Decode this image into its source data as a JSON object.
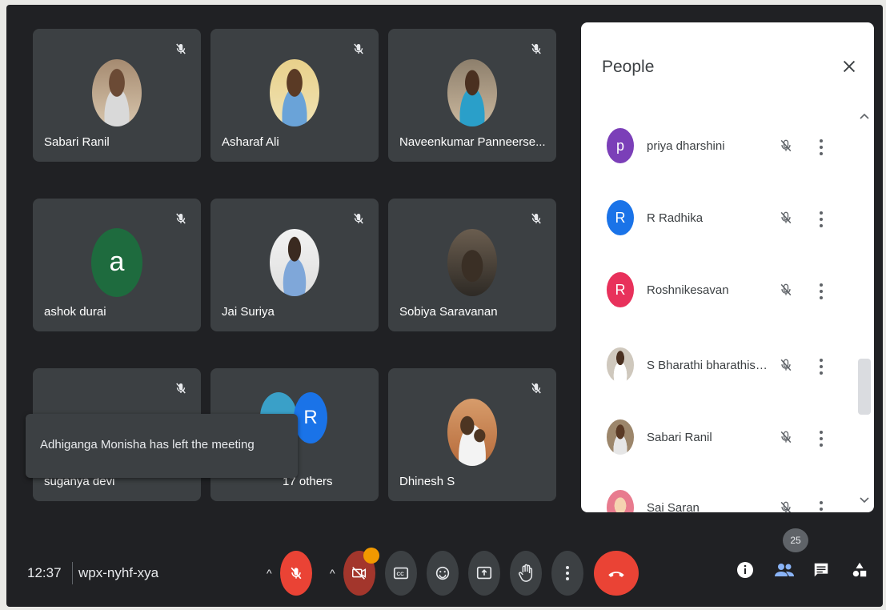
{
  "tiles": [
    {
      "name": "Sabari Ranil"
    },
    {
      "name": "Asharaf Ali"
    },
    {
      "name": "Naveenkumar Panneerse..."
    },
    {
      "name": "ashok durai",
      "initial": "a"
    },
    {
      "name": "Jai Suriya"
    },
    {
      "name": "Sobiya Saravanan"
    },
    {
      "name": "suganya devi"
    },
    {
      "name": "17 others",
      "initial": "R"
    },
    {
      "name": "Dhinesh S"
    }
  ],
  "toast": {
    "text": "Adhiganga Monisha has left the meeting"
  },
  "people_panel": {
    "title": "People",
    "participants": [
      {
        "name": "priya dharshini",
        "initial": "p",
        "color": "#7b3fb8"
      },
      {
        "name": "R Radhika",
        "initial": "R",
        "color": "#1a73e8"
      },
      {
        "name": "Roshnikesavan",
        "initial": "R",
        "color": "#e8315b"
      },
      {
        "name": "S Bharathi bharathisel...",
        "initial": ""
      },
      {
        "name": "Sabari Ranil",
        "initial": ""
      },
      {
        "name": "Sai Saran",
        "initial": ""
      }
    ]
  },
  "bottom_bar": {
    "time": "12:37",
    "meeting_code": "wpx-nyhf-xya",
    "participant_count": "25",
    "icons": [
      "mic-off-icon",
      "camera-off-icon",
      "captions-icon",
      "emoji-icon",
      "present-icon",
      "raise-hand-icon",
      "more-options-icon",
      "end-call-icon",
      "info-icon",
      "people-icon",
      "chat-icon",
      "activities-icon"
    ]
  },
  "colors": {
    "background": "#202124",
    "tile": "#3c4043",
    "end_call": "#ea4335",
    "accent": "#1a73e8"
  }
}
